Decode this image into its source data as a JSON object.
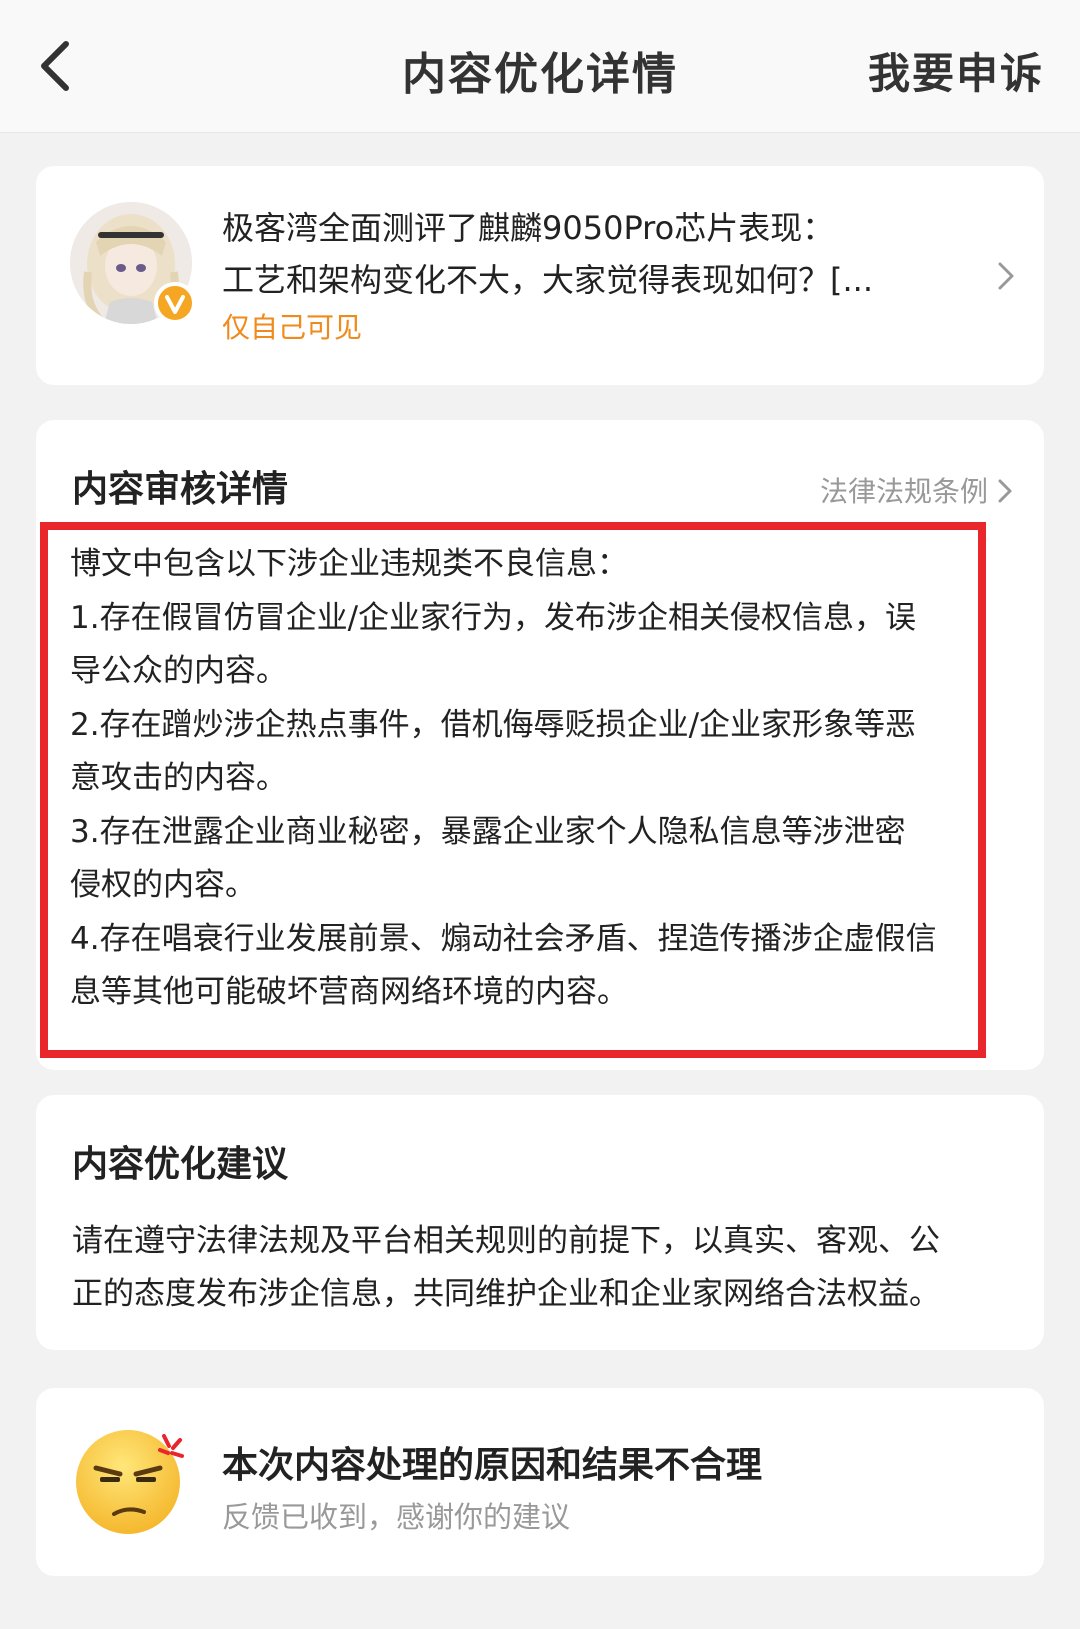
{
  "header": {
    "title": "内容优化详情",
    "appeal_label": "我要申诉"
  },
  "post": {
    "title_line1": "极客湾全面测评了麒麟9050Pro芯片表现：",
    "title_line2": "工艺和架构变化不大，大家觉得表现如何？[...",
    "visibility": "仅自己可见"
  },
  "review": {
    "section_title": "内容审核详情",
    "law_link": "法律法规条例",
    "lines": [
      "博文中包含以下涉企业违规类不良信息：",
      "1.存在假冒仿冒企业/企业家行为，发布涉企相关侵权信息，误",
      "导公众的内容。",
      "2.存在蹭炒涉企热点事件，借机侮辱贬损企业/企业家形象等恶",
      "意攻击的内容。",
      "3.存在泄露企业商业秘密，暴露企业家个人隐私信息等涉泄密",
      "侵权的内容。",
      "4.存在唱衰行业发展前景、煽动社会矛盾、捏造传播涉企虚假信",
      "息等其他可能破坏营商网络环境的内容。"
    ]
  },
  "suggestion": {
    "section_title": "内容优化建议",
    "lines": [
      "请在遵守法律法规及平台相关规则的前提下，以真实、客观、公",
      "正的态度发布涉企信息，共同维护企业和企业家网络合法权益。"
    ]
  },
  "feedback": {
    "title": "本次内容处理的原因和结果不合理",
    "subtitle": "反馈已收到，感谢你的建议"
  },
  "colors": {
    "accent_orange": "#f08a1c",
    "highlight_red": "#e8262b",
    "muted_gray": "#999999"
  },
  "icons": [
    "back-arrow-icon",
    "chevron-right-icon",
    "verified-v-badge-icon",
    "angry-emoji-icon"
  ]
}
